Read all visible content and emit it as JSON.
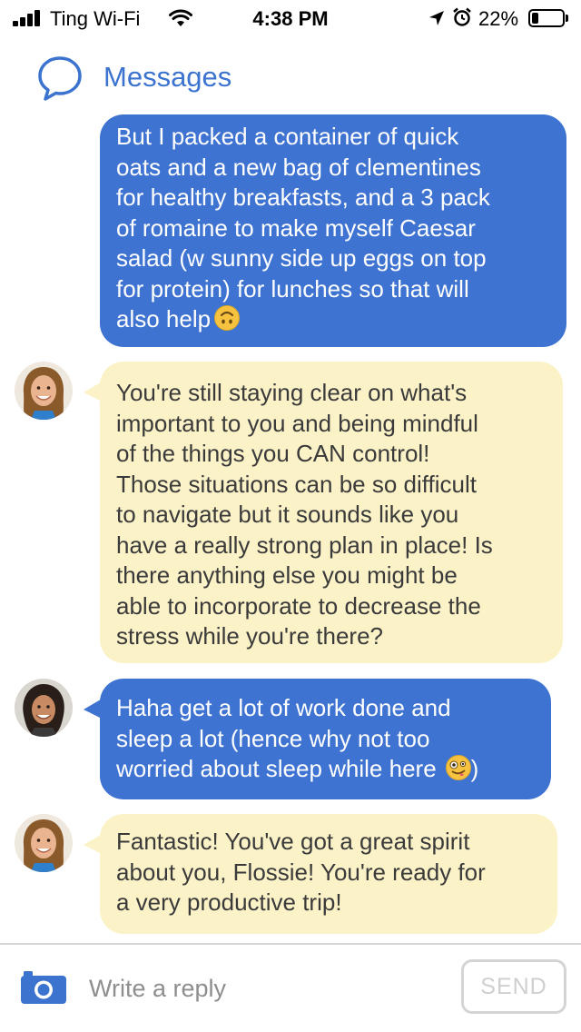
{
  "status_bar": {
    "carrier": "Ting Wi-Fi",
    "time": "4:38 PM",
    "battery_percent": "22%",
    "battery_level": 0.22,
    "icons": [
      "signal-icon",
      "wifi-icon",
      "location-arrow-icon",
      "alarm-clock-icon",
      "battery-icon"
    ]
  },
  "header": {
    "title": "Messages",
    "icon": "speech-bubble-icon"
  },
  "colors": {
    "accent": "#3b73cf",
    "sent_bubble": "#3e73d1",
    "received_bubble": "#fcf2c8"
  },
  "messages": [
    {
      "direction": "sent",
      "lines": [
        "But I packed a container of quick",
        "oats and a new bag of clementines",
        "for healthy breakfasts, and a 3 pack",
        "of romaine to make myself Caesar",
        "salad (w sunny side up eggs on top",
        "for protein) for lunches so that will",
        "also help"
      ],
      "emoji": "upside-down-face"
    },
    {
      "direction": "received",
      "avatar": "coach-avatar",
      "lines": [
        "You're still staying clear on what's",
        "important to you and being mindful",
        "of the things you CAN control!",
        "Those situations can be so difficult",
        "to navigate but it sounds like you",
        "have a really strong plan in place! Is",
        "there anything else you might be",
        "able to incorporate to decrease the",
        "stress while you're there?"
      ]
    },
    {
      "direction": "sent",
      "avatar": "user-avatar",
      "lines": [
        "Haha get a lot of work done and",
        "sleep a lot (hence why not too",
        "worried about sleep while here"
      ],
      "emoji": "zany-face",
      "trailing_text": ")"
    },
    {
      "direction": "received",
      "avatar": "coach-avatar",
      "lines": [
        "Fantastic! You've got a great spirit",
        "about you, Flossie! You're ready for",
        "a very productive trip!"
      ]
    }
  ],
  "composer": {
    "placeholder": "Write a reply",
    "value": "",
    "send_label": "SEND",
    "camera_icon": "camera-icon"
  }
}
